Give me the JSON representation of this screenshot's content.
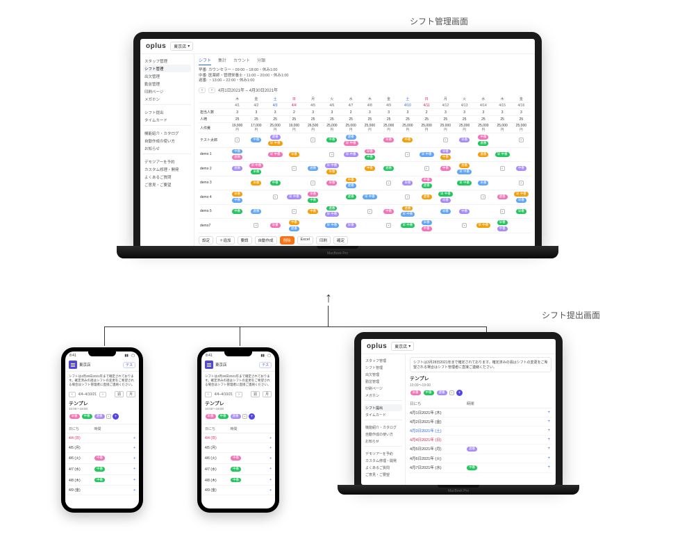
{
  "labels": {
    "management_screen": "シフト管理画面",
    "submit_screen": "シフト提出画面",
    "macbook": "MacBook Pro"
  },
  "brand": "oplus",
  "store_name": "東京店",
  "sidebar": {
    "items": [
      "スタッフ管理",
      "シフト管理",
      "出欠管理",
      "勤怠管理",
      "印刷ページ",
      "メガホン",
      "シフト提出",
      "タイムカード",
      "機能紹介・カタログ",
      "自動作成の使い方",
      "お知らせ",
      "デモツアーを予約",
      "カスタム修理・開発",
      "よくあるご質問",
      "ご意見・ご要望"
    ],
    "active_index": 1
  },
  "tabs": [
    "シフト",
    "集計",
    "カウント",
    "分類"
  ],
  "legend": {
    "line1": "早番: カウンセラー・09:00 – 18:00・休み1:00",
    "line2": "中番: 医薬師・管理栄養士・11:00 – 20:00・休み1:00",
    "line3": "遅番: ・13:00 – 22:00・休み1:00"
  },
  "date_range": "4月1日2021年 – 4月30日2021年",
  "grid": {
    "header_dow": [
      "木",
      "金",
      "土",
      "日",
      "月",
      "火",
      "水",
      "木",
      "金",
      "土",
      "日",
      "月",
      "火",
      "水",
      "木",
      "金"
    ],
    "header_dates": [
      "4/1",
      "4/2",
      "4/3",
      "4/4",
      "4/5",
      "4/6",
      "4/7",
      "4/8",
      "4/9",
      "4/10",
      "4/11",
      "4/12",
      "4/13",
      "4/14",
      "4/15",
      "4/16"
    ],
    "rows": {
      "count_label": "担当人数",
      "count": [
        "3",
        "3",
        "3",
        "2",
        "3",
        "3",
        "2",
        "3",
        "3",
        "3",
        "2",
        "3",
        "3",
        "3",
        "3",
        "3"
      ],
      "people_label": "人椅",
      "people": [
        "25",
        "25",
        "25",
        "25",
        "25",
        "25",
        "25",
        "25",
        "25",
        "25",
        "25",
        "25",
        "25",
        "25",
        "25",
        "25"
      ],
      "cost_label": "人件費",
      "cost": [
        "19,900",
        "17,000",
        "25,000",
        "19,000",
        "26,500",
        "25,000",
        "25,000",
        "25,000",
        "25,000",
        "25,000",
        "25,000",
        "25,000",
        "25,000",
        "25,000",
        "25,000",
        "25,000"
      ],
      "yen": "円"
    },
    "staff": [
      "テスト太郎",
      "demo 1",
      "demo 2",
      "demo 3",
      "demo 4",
      "demo 5",
      "demo7"
    ]
  },
  "shift_pills": {
    "early": "早番",
    "mid": "中番",
    "late": "遅番",
    "early_mid": "早 中番"
  },
  "toolbar": {
    "settei": "設定",
    "add": "＋追加",
    "req": "要請",
    "auto": "自動作成",
    "delete": "削除",
    "excel": "Excel",
    "print": "印刷",
    "confirm": "確定"
  },
  "submit": {
    "notice": "シフトは3月28日2021年まで確定されております。確定済みの週はシフトの変更をご希望される場合はシフト管理者に直接ご連絡ください。",
    "template_title": "テンプレ",
    "template_sub": "10:00～19:00",
    "date_range_short": "4/4–4/10/21",
    "week_btn": "週",
    "month_btn": "月",
    "col_date": "日にち",
    "col_time": "時間",
    "rows": [
      {
        "d": "4月1日2021年 (木)",
        "cls": ""
      },
      {
        "d": "4月2日2021年 (金)",
        "cls": ""
      },
      {
        "d": "4月3日2021年 (土)",
        "cls": "sat-t"
      },
      {
        "d": "4月4日2021年 (日)",
        "cls": "sun-t"
      },
      {
        "d": "4月5日2021年 (月)",
        "cls": ""
      },
      {
        "d": "4月6日2021年 (火)",
        "cls": ""
      },
      {
        "d": "4月7日2021年 (水)",
        "cls": ""
      }
    ]
  },
  "phone": {
    "time": "8:41",
    "badge": "テス",
    "notice": "シフトは3月28日2021年まで確定されております。確定済みの週はシフトの変更をご希望される場合はシフト管理者に直接ご連絡ください。",
    "range": "4/4–4/10/21",
    "rows": [
      {
        "d": "4/4 (日)",
        "cls": "sun-t",
        "pill": ""
      },
      {
        "d": "4/5 (月)",
        "cls": "",
        "pill": ""
      },
      {
        "d": "4/6 (火)",
        "cls": "",
        "pill": "p-pk"
      },
      {
        "d": "4/7 (水)",
        "cls": "",
        "pill": "p-g"
      },
      {
        "d": "4/8 (木)",
        "cls": "",
        "pill": "p-g"
      },
      {
        "d": "4/9 (金)",
        "cls": "",
        "pill": ""
      }
    ]
  }
}
